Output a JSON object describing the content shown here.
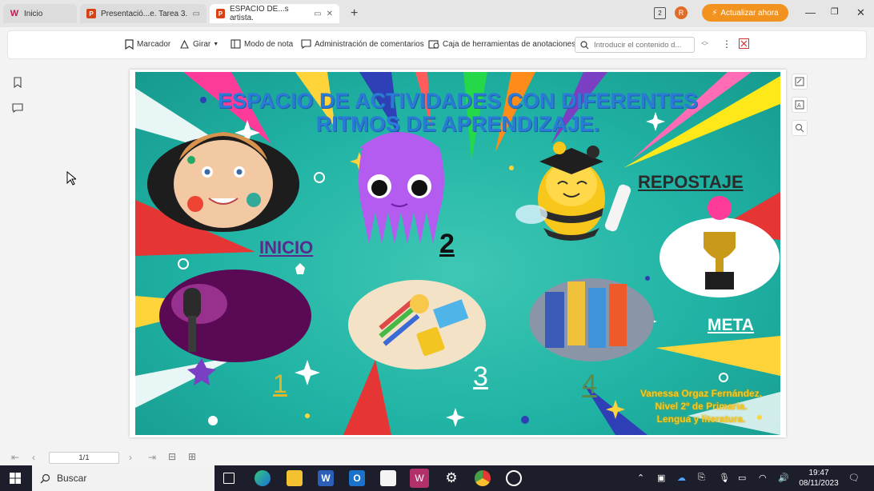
{
  "tabs": [
    {
      "label": "Inicio",
      "icon": "wps-icon",
      "color": "#c2185b"
    },
    {
      "label": "Presentació...e. Tarea 3.",
      "icon": "presentation-icon",
      "color": "#d84315"
    },
    {
      "label": "ESPACIO DE...s artista.",
      "icon": "presentation-icon",
      "color": "#d84315"
    }
  ],
  "window": {
    "avatar_letter": "R",
    "update_label": "Actualizar ahora",
    "page_badge": "2"
  },
  "toolbar": {
    "marcador": "Marcador",
    "girar": "Girar",
    "modo_nota": "Modo de nota",
    "comentarios": "Administración de comentarios",
    "anotaciones": "Caja de herramientas de anotaciones",
    "search_placeholder": "Introducir el contenido d..."
  },
  "slide": {
    "title_line1": "ESPACIO DE ACTIVIDADES CON DIFERENTES",
    "title_line2": "RITMOS DE APRENDIZAJE.",
    "inicio": "INICIO",
    "repostaje": "REPOSTAJE",
    "meta": "META",
    "n1": "1",
    "n2": "2",
    "n3": "3",
    "n4": "4",
    "credit1": "Vanessa Orgaz Fernández.",
    "credit2": "Nivel 2º de Primaria.",
    "credit3": "Lengua y literatura.",
    "colors": {
      "title": "#2a7bd6",
      "inicio": "#5a2a8c",
      "meta": "#ffffff",
      "credits": "#f6c821"
    }
  },
  "statusbar": {
    "page": "1/1"
  },
  "taskbar": {
    "search_label": "Buscar",
    "time": "19:47",
    "date": "08/11/2023"
  }
}
